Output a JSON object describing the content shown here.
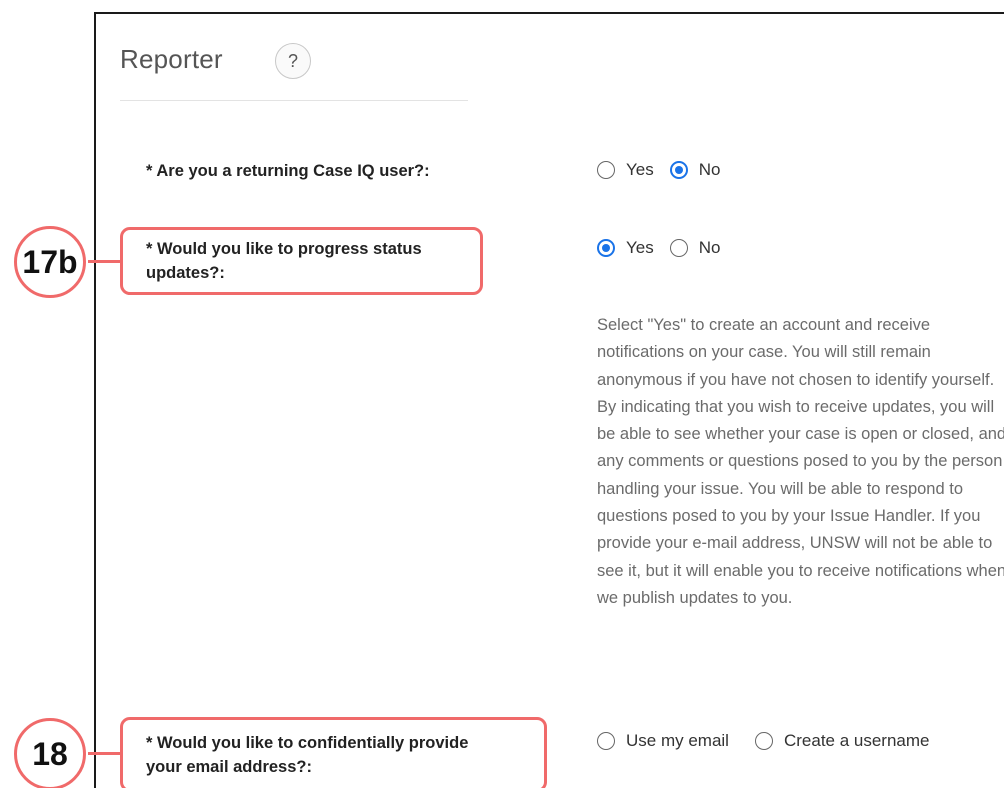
{
  "section": {
    "title": "Reporter",
    "help_label": "?"
  },
  "questions": [
    {
      "label": "* Are you a returning Case IQ user?:",
      "options": [
        {
          "label": "Yes",
          "checked": false
        },
        {
          "label": "No",
          "checked": true
        }
      ]
    },
    {
      "label_line1": "* Would you like to progress status",
      "label_line2": "updates?:",
      "options": [
        {
          "label": "Yes",
          "checked": true
        },
        {
          "label": "No",
          "checked": false
        }
      ],
      "help_text": "Select \"Yes\" to create an account and receive notifications on your case. You will still remain anonymous if you have not chosen to identify yourself. By indicating that you wish to receive updates, you will be able to see whether your case is open or closed, and any comments or questions posed to you by the person handling your issue. You will be able to respond to questions posed to you by your Issue Handler. If you provide your e-mail address, UNSW will not be able to see it, but it will enable you to receive notifications when we publish updates to you."
    },
    {
      "label_line1": "* Would you like to confidentially provide",
      "label_line2": "your email address?:",
      "options": [
        {
          "label": "Use my email",
          "checked": false
        },
        {
          "label": "Create a username",
          "checked": false
        }
      ]
    }
  ],
  "annotations": {
    "step_17b": "17b",
    "step_18": "18",
    "highlight_color": "#f06a6a"
  },
  "colors": {
    "radio_accent": "#1a73e8",
    "help_text": "#6b6b6b"
  }
}
